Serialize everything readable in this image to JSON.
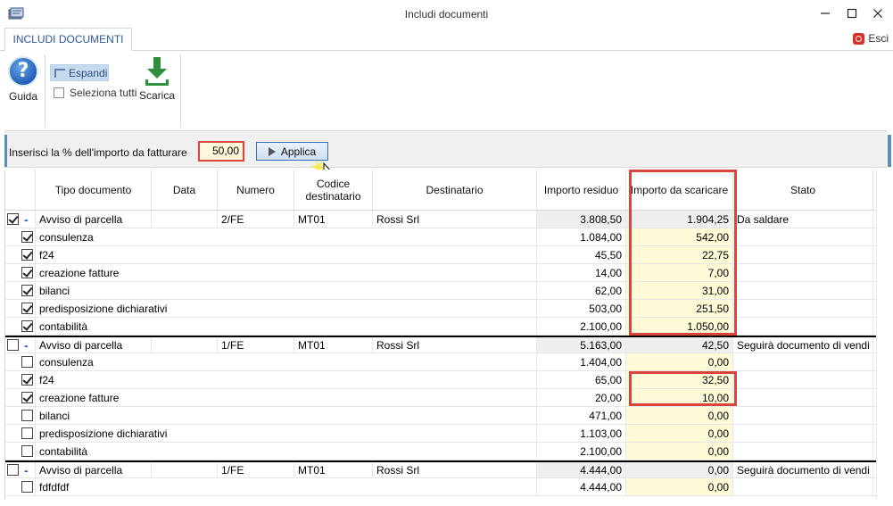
{
  "window": {
    "title": "Includi documenti",
    "controls": [
      "minimize",
      "maximize",
      "close"
    ]
  },
  "ribbon": {
    "tab_label": "INCLUDI DOCUMENTI",
    "exit_label": "Esci",
    "guida_label": "Guida",
    "espandi_label": "Espandi",
    "seleziona_tutti_label": "Seleziona tutti",
    "scarica_label": "Scarica"
  },
  "strip": {
    "label": "Inserisci la % dell'importo da fatturare",
    "percent_value": "50,00",
    "apply_label": "Applica"
  },
  "grid": {
    "columns": [
      "Tipo documento",
      "Data",
      "Numero",
      "Codice destinatario",
      "Destinatario",
      "Importo residuo",
      "Importo da scaricare",
      "Stato"
    ],
    "groups": [
      {
        "checked": true,
        "expander": "-",
        "tipo": "Avviso di parcella",
        "data": "",
        "numero": "2/FE",
        "codice": "MT01",
        "destinatario": "Rossi Srl",
        "importo_residuo": "3.808,50",
        "importo_scaricare": "1.904,25",
        "stato": "Da saldare",
        "items": [
          {
            "checked": true,
            "desc": "consulenza",
            "residuo": "1.084,00",
            "scaricare": "542,00"
          },
          {
            "checked": true,
            "desc": "f24",
            "residuo": "45,50",
            "scaricare": "22,75"
          },
          {
            "checked": true,
            "desc": "creazione fatture",
            "residuo": "14,00",
            "scaricare": "7,00"
          },
          {
            "checked": true,
            "desc": "bilanci",
            "residuo": "62,00",
            "scaricare": "31,00"
          },
          {
            "checked": true,
            "desc": "predisposizione dichiarativi",
            "residuo": "503,00",
            "scaricare": "251,50"
          },
          {
            "checked": true,
            "desc": "contabilità",
            "residuo": "2.100,00",
            "scaricare": "1.050,00"
          }
        ]
      },
      {
        "checked": false,
        "expander": "-",
        "tipo": "Avviso di parcella",
        "data": "",
        "numero": "1/FE",
        "codice": "MT01",
        "destinatario": "Rossi Srl",
        "importo_residuo": "5.163,00",
        "importo_scaricare": "42,50",
        "stato": "Seguirà documento di vendi",
        "items": [
          {
            "checked": false,
            "desc": "consulenza",
            "residuo": "1.404,00",
            "scaricare": "0,00"
          },
          {
            "checked": true,
            "desc": "f24",
            "residuo": "65,00",
            "scaricare": "32,50"
          },
          {
            "checked": true,
            "desc": "creazione fatture",
            "residuo": "20,00",
            "scaricare": "10,00"
          },
          {
            "checked": false,
            "desc": "bilanci",
            "residuo": "471,00",
            "scaricare": "0,00"
          },
          {
            "checked": false,
            "desc": "predisposizione dichiarativi",
            "residuo": "1.103,00",
            "scaricare": "0,00"
          },
          {
            "checked": false,
            "desc": "contabilità",
            "residuo": "2.100,00",
            "scaricare": "0,00"
          }
        ]
      },
      {
        "checked": false,
        "expander": "-",
        "tipo": "Avviso di parcella",
        "data": "",
        "numero": "1/FE",
        "codice": "MT01",
        "destinatario": "Rossi Srl",
        "importo_residuo": "4.444,00",
        "importo_scaricare": "0,00",
        "stato": "Seguirà documento di vendi",
        "items": [
          {
            "checked": false,
            "desc": "fdfdfdf",
            "residuo": "4.444,00",
            "scaricare": "0,00"
          }
        ]
      }
    ]
  },
  "colors": {
    "highlight_box": "#d9453b",
    "accent": "#2b5797",
    "editable_cell": "#fffbd9"
  }
}
